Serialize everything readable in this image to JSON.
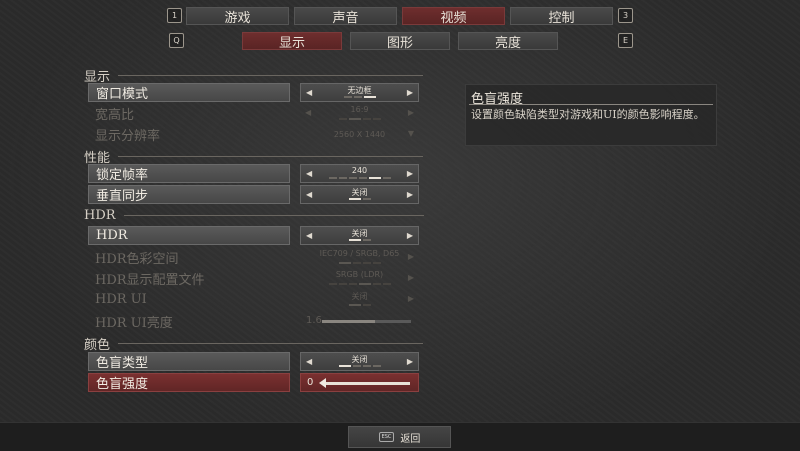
{
  "top_tabs": {
    "key_left": "1",
    "key_right": "3",
    "items": [
      {
        "label": "游戏",
        "active": false
      },
      {
        "label": "声音",
        "active": false
      },
      {
        "label": "视频",
        "active": true
      },
      {
        "label": "控制",
        "active": false
      }
    ]
  },
  "sub_tabs": {
    "key_left": "Q",
    "key_right": "E",
    "items": [
      {
        "label": "显示",
        "active": true
      },
      {
        "label": "图形",
        "active": false
      },
      {
        "label": "亮度",
        "active": false
      }
    ]
  },
  "sections": {
    "display": {
      "title": "显示",
      "window_mode": {
        "label": "窗口模式",
        "value": "无边框"
      },
      "aspect_ratio": {
        "label": "宽高比",
        "value": "16:9"
      },
      "resolution": {
        "label": "显示分辨率",
        "value": "2560 X 1440"
      }
    },
    "performance": {
      "title": "性能",
      "frame_lock": {
        "label": "锁定帧率",
        "value": "240"
      },
      "vsync": {
        "label": "垂直同步",
        "value": "关闭"
      }
    },
    "hdr": {
      "title": "HDR",
      "hdr": {
        "label": "HDR",
        "value": "关闭"
      },
      "color_space": {
        "label": "HDR色彩空间",
        "value": "IEC709 / SRGB, D65"
      },
      "profile": {
        "label": "HDR显示配置文件",
        "value": "SRGB (LDR)"
      },
      "hdr_ui": {
        "label": "HDR UI",
        "value": "关闭"
      },
      "hdr_ui_brightness": {
        "label": "HDR UI亮度",
        "value": "1.6",
        "level": 0.6
      }
    },
    "color": {
      "title": "颜色",
      "cb_type": {
        "label": "色盲类型",
        "value": "关闭"
      },
      "cb_strength": {
        "label": "色盲强度",
        "value": "0",
        "level": 0.0
      }
    }
  },
  "tooltip": {
    "title": "色盲强度",
    "body": "设置颜色缺陷类型对游戏和UI的颜色影响程度。"
  },
  "footer": {
    "esc_key": "ESC",
    "back_label": "返回"
  }
}
